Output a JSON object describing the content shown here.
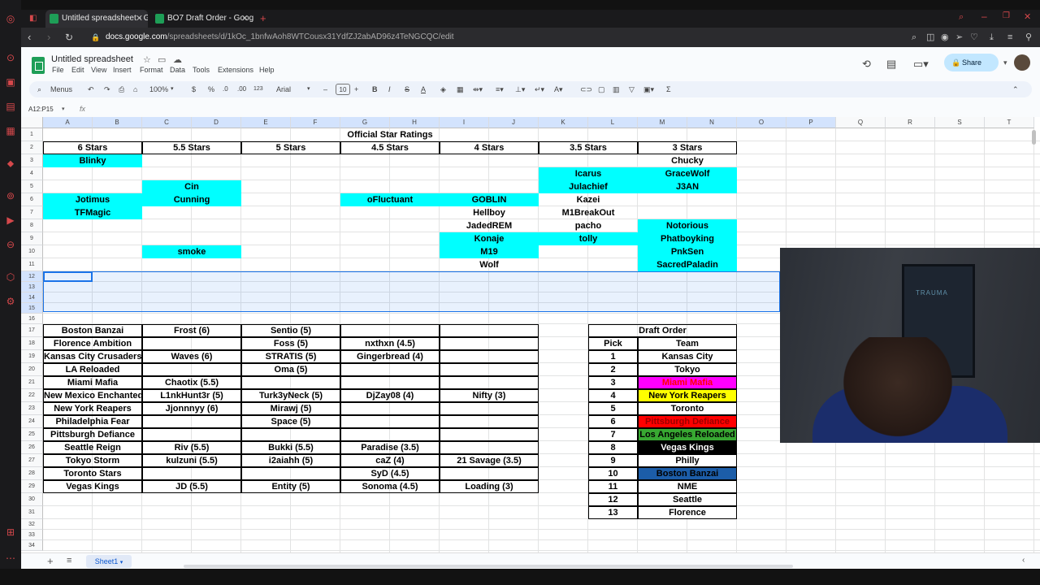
{
  "browser": {
    "tabs": [
      {
        "title": "Untitled spreadsheet - Goo",
        "active": true
      },
      {
        "title": "BO7 Draft Order - Google S",
        "active": false
      }
    ],
    "new_tab": "+",
    "url_host": "docs.google.com",
    "url_path": "/spreadsheets/d/1kOc_1bnfwAoh8WTCousx31YdfZJ2abAD96z4TeNGCQC/edit"
  },
  "sheets": {
    "title": "Untitled spreadsheet",
    "menus": [
      "File",
      "Edit",
      "View",
      "Insert",
      "Format",
      "Data",
      "Tools",
      "Extensions",
      "Help"
    ],
    "share_label": "Share",
    "toolbar": {
      "menus_label": "Menus",
      "zoom": "100%",
      "currency": "$",
      "percent": "%",
      "dec_less": ".0",
      "dec_more": ".00",
      "number_format": "123",
      "font": "Arial",
      "font_size": "10"
    },
    "name_box": "A12:P15",
    "fx": "fx",
    "sheet_tab": "Sheet1",
    "columns": [
      "A",
      "B",
      "C",
      "D",
      "E",
      "F",
      "G",
      "H",
      "I",
      "J",
      "K",
      "L",
      "M",
      "N",
      "O",
      "P",
      "Q",
      "R",
      "S",
      "T"
    ],
    "rows": [
      "1",
      "2",
      "3",
      "4",
      "5",
      "6",
      "7",
      "8",
      "9",
      "10",
      "11",
      "12",
      "13",
      "14",
      "15",
      "16",
      "17",
      "18",
      "19",
      "20",
      "21",
      "22",
      "23",
      "24",
      "25",
      "26",
      "27",
      "28",
      "29",
      "30",
      "31",
      "32",
      "33",
      "34"
    ]
  },
  "star_ratings": {
    "title": "Official Star Ratings",
    "headers": [
      "6 Stars",
      "5.5 Stars",
      "5 Stars",
      "4.5 Stars",
      "4 Stars",
      "3.5 Stars",
      "3 Stars"
    ],
    "six": [
      "Blinky",
      "Jotimus",
      "TFMagic"
    ],
    "five_half": [
      "Cin",
      "Cunning",
      "smoke"
    ],
    "four_half": [
      "oFluctuant"
    ],
    "four": [
      "GOBLIN",
      "Hellboy",
      "JadedREM",
      "Konaje",
      "M19",
      "Wolf"
    ],
    "three_half": [
      "Icarus",
      "Julachief",
      "Kazei",
      "M1BreakOut",
      "pacho",
      "tolly"
    ],
    "three": [
      "Chucky",
      "GraceWolf",
      "J3AN",
      "Notorious",
      "Phatboyking",
      "PnkSen",
      "SacredPaladin"
    ]
  },
  "teams": [
    {
      "name": "Boston Banzai",
      "players": [
        "Frost (6)",
        "Sentio (5)",
        "",
        ""
      ]
    },
    {
      "name": "Florence Ambition",
      "players": [
        "",
        "Foss (5)",
        "nxthxn (4.5)",
        ""
      ]
    },
    {
      "name": "Kansas City Crusaders",
      "players": [
        "Waves (6)",
        "STRATIS (5)",
        "Gingerbread (4)",
        ""
      ]
    },
    {
      "name": "LA Reloaded",
      "players": [
        "",
        "Oma (5)",
        "",
        ""
      ]
    },
    {
      "name": "Miami Mafia",
      "players": [
        "Chaotix (5.5)",
        "",
        "",
        ""
      ]
    },
    {
      "name": "New Mexico Enchanted",
      "players": [
        "L1nkHunt3r (5)",
        "Turk3yNeck (5)",
        "DjZay08 (4)",
        "Nifty (3)"
      ]
    },
    {
      "name": "New York Reapers",
      "players": [
        "Jjonnnyy (6)",
        "Mirawj (5)",
        "",
        ""
      ]
    },
    {
      "name": "Philadelphia Fear",
      "players": [
        "",
        "Space (5)",
        "",
        ""
      ]
    },
    {
      "name": "Pittsburgh Defiance",
      "players": [
        "",
        "",
        "",
        ""
      ]
    },
    {
      "name": "Seattle Reign",
      "players": [
        "Riv (5.5)",
        "Bukki (5.5)",
        "Paradise (3.5)",
        ""
      ]
    },
    {
      "name": "Tokyo Storm",
      "players": [
        "kulzuni (5.5)",
        "i2aiahh (5)",
        "caZ (4)",
        "21 Savage (3.5)"
      ]
    },
    {
      "name": "Toronto Stars",
      "players": [
        "",
        "",
        "SyD (4.5)",
        ""
      ]
    },
    {
      "name": "Vegas Kings",
      "players": [
        "JD (5.5)",
        "Entity (5)",
        "Sonoma (4.5)",
        "Loading (3)"
      ]
    }
  ],
  "draft_order": {
    "title": "Draft Order",
    "pick_header": "Pick",
    "team_header": "Team",
    "rows": [
      {
        "pick": "1",
        "team": "Kansas City",
        "bg": "#ffffff",
        "fg": "#000000"
      },
      {
        "pick": "2",
        "team": "Tokyo",
        "bg": "#ffffff",
        "fg": "#000000"
      },
      {
        "pick": "3",
        "team": "Miami Mafia",
        "bg": "#ff00ff",
        "fg": "#ff0000"
      },
      {
        "pick": "4",
        "team": "New York Reapers",
        "bg": "#ffff00",
        "fg": "#000000"
      },
      {
        "pick": "5",
        "team": "Toronto",
        "bg": "#ffffff",
        "fg": "#000000"
      },
      {
        "pick": "6",
        "team": "Pittsburgh Defiance",
        "bg": "#ff0000",
        "fg": "#990000"
      },
      {
        "pick": "7",
        "team": "Los Angeles Reloaded",
        "bg": "#38a832",
        "fg": "#000000"
      },
      {
        "pick": "8",
        "team": "Vegas Kings",
        "bg": "#000000",
        "fg": "#ffffff"
      },
      {
        "pick": "9",
        "team": "Philly",
        "bg": "#ffffff",
        "fg": "#000000"
      },
      {
        "pick": "10",
        "team": "Boston Banzai",
        "bg": "#1c5da8",
        "fg": "#000000"
      },
      {
        "pick": "11",
        "team": "NME",
        "bg": "#ffffff",
        "fg": "#000000"
      },
      {
        "pick": "12",
        "team": "Seattle",
        "bg": "#ffffff",
        "fg": "#000000"
      },
      {
        "pick": "13",
        "team": "Florence",
        "bg": "#ffffff",
        "fg": "#000000"
      }
    ]
  },
  "webcam": {
    "poster_text": "TRAUMA"
  },
  "colors": {
    "cyan": "#00ffff",
    "selection": "#1a73e8",
    "share_bg": "#c2e7ff",
    "brand": "#1e9e57"
  }
}
